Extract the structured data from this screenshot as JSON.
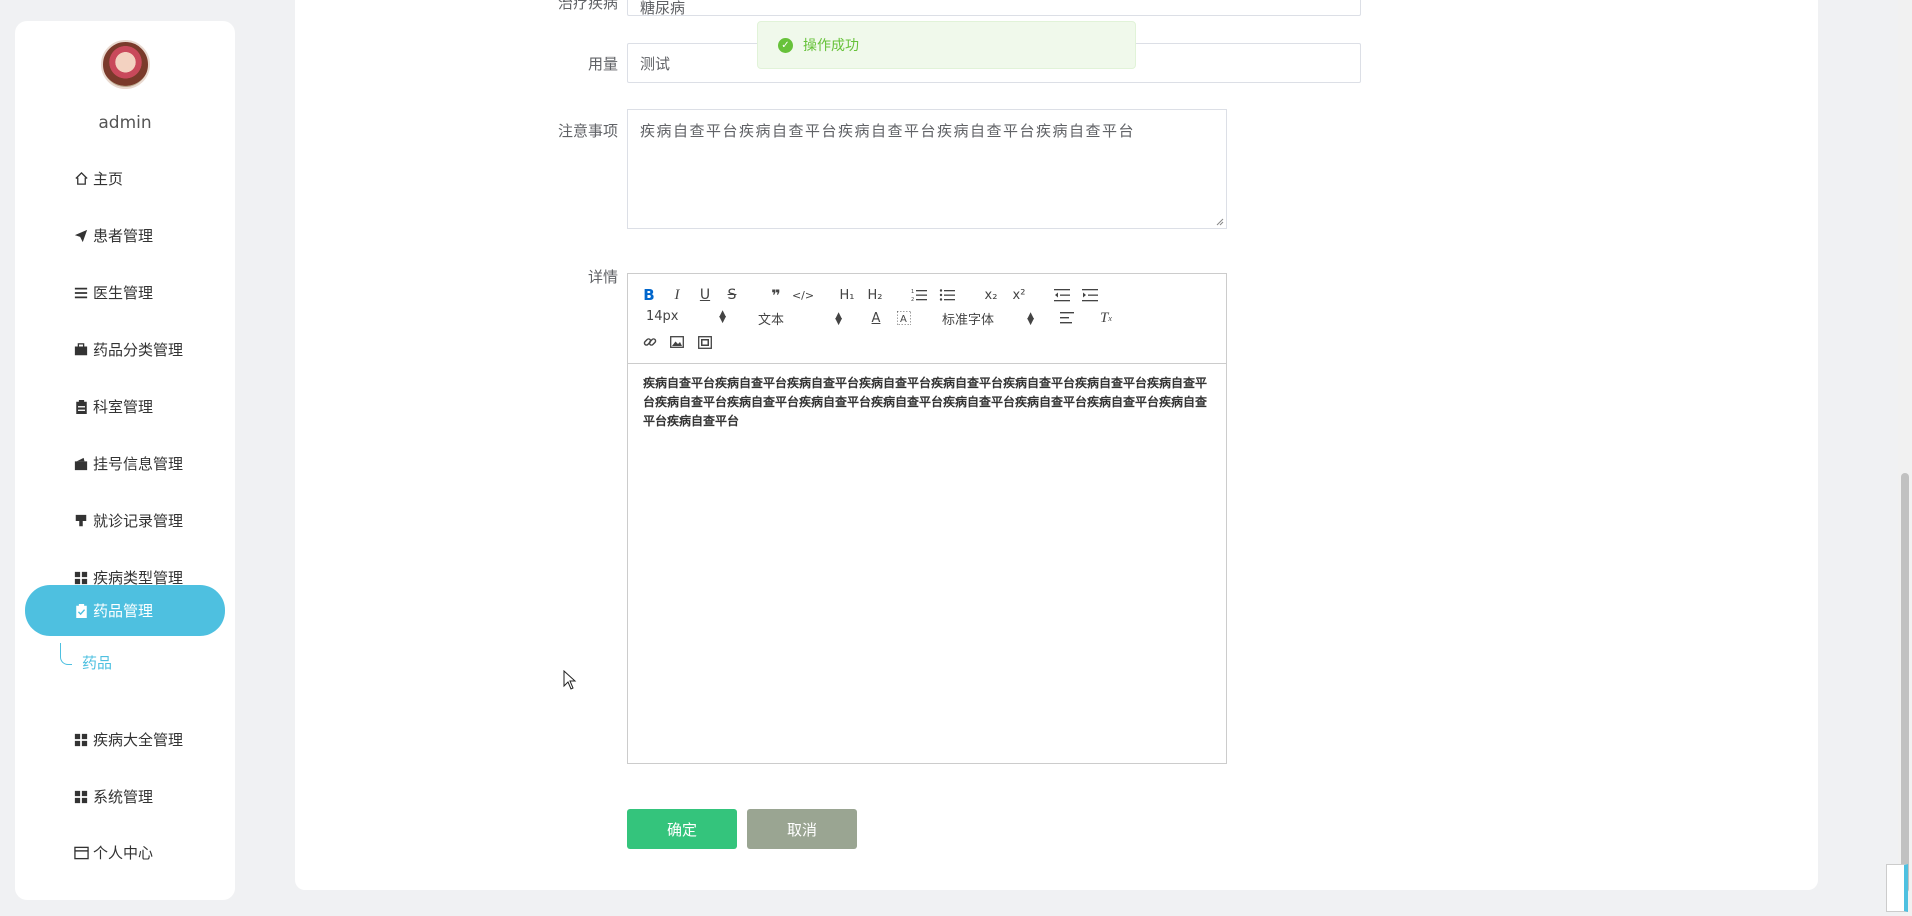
{
  "user": {
    "name": "admin"
  },
  "sidebar": {
    "items": [
      {
        "label": "主页",
        "icon": "home-icon"
      },
      {
        "label": "患者管理",
        "icon": "paper-plane-icon"
      },
      {
        "label": "医生管理",
        "icon": "list-icon"
      },
      {
        "label": "药品分类管理",
        "icon": "briefcase-icon"
      },
      {
        "label": "科室管理",
        "icon": "clipboard-icon"
      },
      {
        "label": "挂号信息管理",
        "icon": "wallet-icon"
      },
      {
        "label": "就诊记录管理",
        "icon": "stamp-icon"
      },
      {
        "label": "疾病类型管理",
        "icon": "grid-icon"
      },
      {
        "label": "药品管理",
        "icon": "clipboard-check-icon",
        "active": true
      },
      {
        "label": "疾病大全管理",
        "icon": "grid-icon"
      },
      {
        "label": "系统管理",
        "icon": "grid-icon"
      },
      {
        "label": "个人中心",
        "icon": "card-icon"
      }
    ],
    "submenu": "药品",
    "accent_color": "#4ec0e0"
  },
  "form": {
    "top_cut_label": "治疗疾病",
    "top_cut_value": "糖尿病",
    "dosage_label": "用量",
    "dosage_value": "测试",
    "notes_label": "注意事项",
    "notes_value": "疾病自查平台疾病自查平台疾病自查平台疾病自查平台疾病自查平台",
    "detail_label": "详情"
  },
  "editor": {
    "font_size": "14px",
    "header": "文本",
    "font": "标准字体",
    "content": "疾病自查平台疾病自查平台疾病自查平台疾病自查平台疾病自查平台疾病自查平台疾病自查平台疾病自查平台疾病自查平台疾病自查平台疾病自查平台疾病自查平台疾病自查平台疾病自查平台疾病自查平台疾病自查平台疾病自查平台"
  },
  "buttons": {
    "confirm": "确定",
    "cancel": "取消"
  },
  "toast": {
    "message": "操作成功"
  }
}
